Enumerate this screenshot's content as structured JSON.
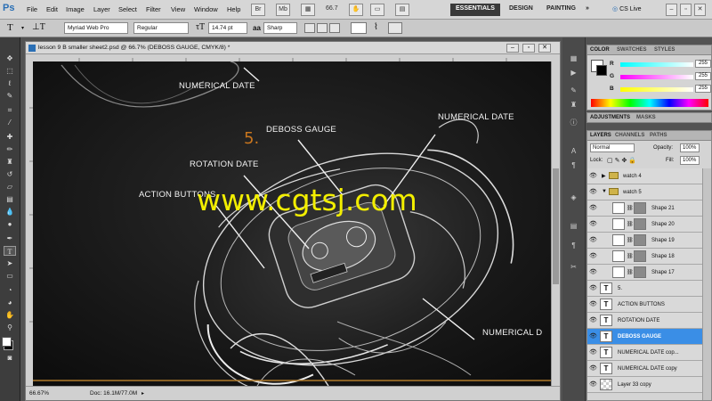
{
  "app": {
    "logo": "Ps"
  },
  "menu": [
    "File",
    "Edit",
    "Image",
    "Layer",
    "Select",
    "Filter",
    "View",
    "Window",
    "Help"
  ],
  "menu_extra": {
    "zoom": "66.7"
  },
  "workspaces": {
    "active": "ESSENTIALS",
    "design": "DESIGN",
    "painting": "PAINTING",
    "more": "»",
    "cslive": "CS Live"
  },
  "options": {
    "font_family": "Myriad Web Pro",
    "font_style": "Regular",
    "font_size": "14.74 pt",
    "anti_alias_icon": "aa",
    "anti_alias": "Sharp"
  },
  "document": {
    "title": "lesson 9 B smaller sheet2.psd @ 66.7% (DEBOSS GAUGE, CMYK/8) *",
    "zoom": "66.67%",
    "doc_size": "Doc: 16.1M/77.0M"
  },
  "canvas": {
    "step_number": "5.",
    "labels": {
      "numerical_date_top": "NUMERICAL DATE",
      "deboss_gauge": "DEBOSS GAUGE",
      "numerical_date_right": "NUMERICAL DATE",
      "rotation_date": "ROTATION DATE",
      "action_buttons": "ACTION BUTTONS",
      "numerical_date_bottom": "NUMERICAL D"
    },
    "watermark": "www.cgtsj.com"
  },
  "color_panel": {
    "tabs": [
      "COLOR",
      "SWATCHES",
      "STYLES"
    ],
    "channels": [
      {
        "label": "R",
        "value": "255"
      },
      {
        "label": "G",
        "value": "255"
      },
      {
        "label": "B",
        "value": "255"
      }
    ]
  },
  "adjustments_panel": {
    "tabs": [
      "ADJUSTMENTS",
      "MASKS"
    ]
  },
  "layers_panel": {
    "tabs": [
      "LAYERS",
      "CHANNELS",
      "PATHS"
    ],
    "blend_mode": "Normal",
    "opacity_label": "Opacity:",
    "opacity": "100%",
    "lock_label": "Lock:",
    "fill_label": "Fill:",
    "fill": "100%",
    "layers": [
      {
        "name": "watch 4",
        "kind": "group"
      },
      {
        "name": "watch 5",
        "kind": "group-open"
      },
      {
        "name": "Shape 21",
        "kind": "shape"
      },
      {
        "name": "Shape 20",
        "kind": "shape"
      },
      {
        "name": "Shape 19",
        "kind": "shape"
      },
      {
        "name": "Shape 18",
        "kind": "shape"
      },
      {
        "name": "Shape 17",
        "kind": "shape"
      },
      {
        "name": "5.",
        "kind": "text"
      },
      {
        "name": "ACTION BUTTONS",
        "kind": "text"
      },
      {
        "name": "ROTATION DATE",
        "kind": "text"
      },
      {
        "name": "DEBOSS GAUGE",
        "kind": "text",
        "selected": true
      },
      {
        "name": "NUMERICAL DATE cop...",
        "kind": "text"
      },
      {
        "name": "NUMERICAL DATE copy",
        "kind": "text"
      },
      {
        "name": "Layer 33 copy",
        "kind": "raster"
      }
    ]
  },
  "colors": {
    "accent_orange": "#c9761e",
    "watermark_yellow": "#f2ee00",
    "selection_blue": "#3a8ee6"
  }
}
